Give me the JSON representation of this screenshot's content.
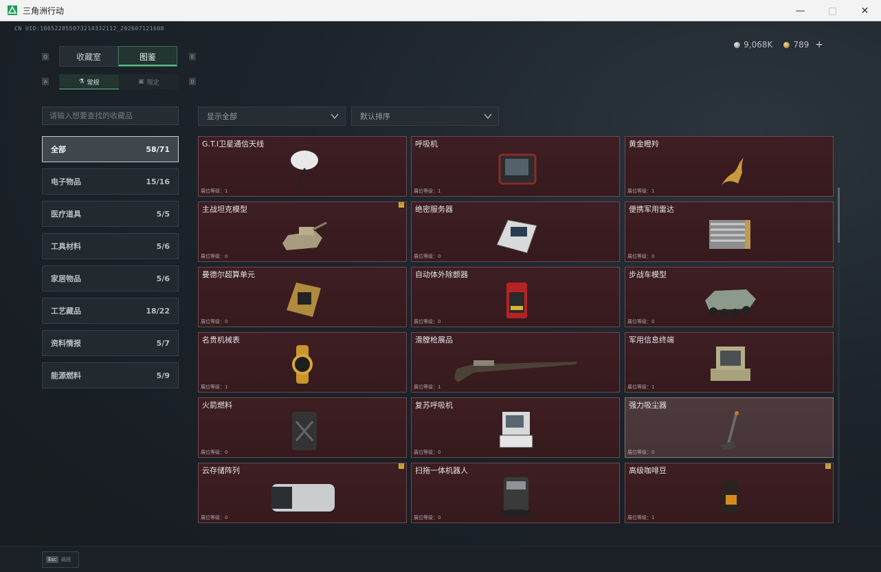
{
  "window": {
    "title": "三角洲行动",
    "minimize_icon": "minimize-icon",
    "maximize_icon": "maximize-icon",
    "close_icon": "close-icon"
  },
  "uid": "CN UID:18652285507321433211​2_202607121608",
  "currency": {
    "silver": "9,068K",
    "gold": "789",
    "plus": "+"
  },
  "keyhints": {
    "q": "Q",
    "e": "E",
    "a": "A",
    "d": "D"
  },
  "tabs": [
    {
      "label": "收藏室"
    },
    {
      "label": "图鉴"
    }
  ],
  "subtabs": [
    {
      "label": "常规"
    },
    {
      "label": "限定"
    }
  ],
  "search": {
    "placeholder": "请输入想要查找的收藏品"
  },
  "filters": {
    "show": "显示全部",
    "sort": "默认排序"
  },
  "categories": [
    {
      "label": "全部",
      "count": "58/71"
    },
    {
      "label": "电子物品",
      "count": "15/16"
    },
    {
      "label": "医疗道具",
      "count": "5/5"
    },
    {
      "label": "工具材料",
      "count": "5/6"
    },
    {
      "label": "家居物品",
      "count": "5/6"
    },
    {
      "label": "工艺藏品",
      "count": "18/22"
    },
    {
      "label": "资料情报",
      "count": "5/7"
    },
    {
      "label": "能源燃料",
      "count": "5/9"
    }
  ],
  "items": [
    {
      "name": "G.T.I卫星通信天线",
      "level": "展位等级：1"
    },
    {
      "name": "呼吸机",
      "level": "展位等级：1"
    },
    {
      "name": "黄金瞪羚",
      "level": "展位等级：1"
    },
    {
      "name": "主战坦克模型",
      "level": "展位等级：0",
      "flag": "!"
    },
    {
      "name": "绝密服务器",
      "level": "展位等级：0"
    },
    {
      "name": "便携军用雷达",
      "level": "展位等级：0"
    },
    {
      "name": "曼德尔超算单元",
      "level": "展位等级：0"
    },
    {
      "name": "自动体外除颤器",
      "level": "展位等级：0"
    },
    {
      "name": "步战车模型",
      "level": "展位等级：0"
    },
    {
      "name": "名贵机械表",
      "level": "展位等级：1"
    },
    {
      "name": "滑膛枪展品",
      "level": "展位等级：1"
    },
    {
      "name": "军用信息终端",
      "level": "展位等级：1"
    },
    {
      "name": "火箭燃料",
      "level": "展位等级：0"
    },
    {
      "name": "复苏呼吸机",
      "level": "展位等级：0"
    },
    {
      "name": "强力吸尘器",
      "level": "展位等级：0"
    },
    {
      "name": "云存储阵列",
      "level": "展位等级：0",
      "flag": "!"
    },
    {
      "name": "扫拖一体机器人",
      "level": "展位等级：0"
    },
    {
      "name": "高级咖啡豆",
      "level": "展位等级：1",
      "flag": "!"
    }
  ],
  "footer": {
    "esc": "Esc",
    "back": "返回"
  }
}
